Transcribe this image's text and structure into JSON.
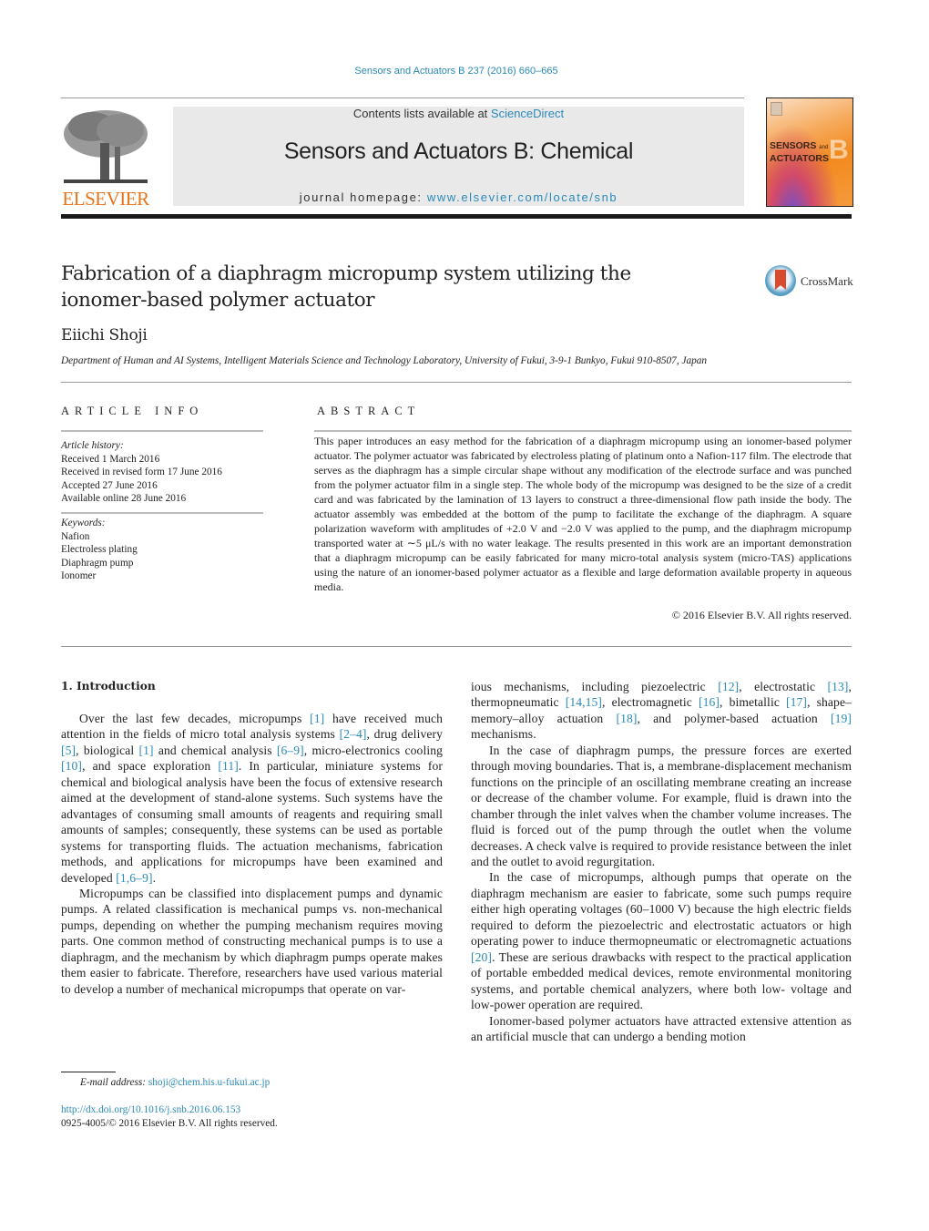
{
  "header": {
    "journal_ref": "Sensors and Actuators B 237 (2016) 660–665",
    "contents_prefix": "Contents lists available at ",
    "contents_link": "ScienceDirect",
    "journal_name": "Sensors and Actuators B: Chemical",
    "homepage_prefix": "journal homepage: ",
    "homepage_link": "www.elsevier.com/locate/snb",
    "publisher_logo_text": "ELSEVIER",
    "cover": {
      "line1": "SENSORS",
      "and": "and",
      "line2": "ACTUATORS",
      "letter": "B"
    },
    "brand_colors": {
      "link": "#2a8ab8",
      "elsevier_orange": "#e8731a",
      "banner_bg": "#e9e9ea"
    }
  },
  "article": {
    "title": "Fabrication of a diaphragm micropump system utilizing the ionomer-based polymer actuator",
    "crossmark_label": "CrossMark",
    "author": "Eiichi Shoji",
    "affiliation": "Department of Human and AI Systems, Intelligent Materials Science and Technology Laboratory, University of Fukui, 3-9-1 Bunkyo, Fukui 910-8507, Japan"
  },
  "article_info": {
    "heading": "ARTICLE INFO",
    "history_label": "Article history:",
    "history": [
      "Received 1 March 2016",
      "Received in revised form 17 June 2016",
      "Accepted 27 June 2016",
      "Available online 28 June 2016"
    ],
    "keywords_label": "Keywords:",
    "keywords": [
      "Nafion",
      "Electroless plating",
      "Diaphragm pump",
      "Ionomer"
    ]
  },
  "abstract": {
    "heading": "ABSTRACT",
    "text": "This paper introduces an easy method for the fabrication of a diaphragm micropump using an ionomer-based polymer actuator. The polymer actuator was fabricated by electroless plating of platinum onto a Nafion-117 film. The electrode that serves as the diaphragm has a simple circular shape without any modification of the electrode surface and was punched from the polymer actuator film in a single step. The whole body of the micropump was designed to be the size of a credit card and was fabricated by the lamination of 13 layers to construct a three-dimensional flow path inside the body. The actuator assembly was embedded at the bottom of the pump to facilitate the exchange of the diaphragm. A square polarization waveform with amplitudes of +2.0 V and −2.0 V was applied to the pump, and the diaphragm micropump transported water at ∼5 μL/s with no water leakage. The results presented in this work are an important demonstration that a diaphragm micropump can be easily fabricated for many micro-total analysis system (micro-TAS) applications using the nature of an ionomer-based polymer actuator as a flexible and large deformation available property in aqueous media.",
    "copyright": "© 2016 Elsevier B.V. All rights reserved."
  },
  "body": {
    "section_heading": "1.  Introduction",
    "left_paragraphs": [
      [
        {
          "t": "Over the last few decades, micropumps "
        },
        {
          "c": "[1]"
        },
        {
          "t": " have received much attention in the fields of micro total analysis systems "
        },
        {
          "c": "[2–4]"
        },
        {
          "t": ", drug delivery "
        },
        {
          "c": "[5]"
        },
        {
          "t": ", biological "
        },
        {
          "c": "[1]"
        },
        {
          "t": " and chemical analysis "
        },
        {
          "c": "[6–9]"
        },
        {
          "t": ", micro-electronics cooling "
        },
        {
          "c": "[10]"
        },
        {
          "t": ", and space exploration "
        },
        {
          "c": "[11]"
        },
        {
          "t": ". In particular, miniature systems for chemical and biological analysis have been the focus of extensive research aimed at the development of stand-alone systems. Such systems have the advantages of consuming small amounts of reagents and requiring small amounts of samples; consequently, these systems can be used as portable systems for transporting fluids. The actuation mechanisms, fabrication methods, and applications for micropumps have been examined and developed "
        },
        {
          "c": "[1,6–9]"
        },
        {
          "t": "."
        }
      ],
      [
        {
          "t": "Micropumps can be classified into displacement pumps and dynamic pumps. A related classification is mechanical pumps vs. non-mechanical pumps, depending on whether the pumping mechanism requires moving parts. One common method of constructing mechanical pumps is to use a diaphragm, and the mechanism by which diaphragm pumps operate makes them easier to fabricate. Therefore, researchers have used various material to develop a number of mechanical micropumps that operate on var-"
        }
      ]
    ],
    "right_paragraphs": [
      [
        {
          "t": "ious mechanisms, including piezoelectric "
        },
        {
          "c": "[12]"
        },
        {
          "t": ", electrostatic "
        },
        {
          "c": "[13]"
        },
        {
          "t": ", thermopneumatic "
        },
        {
          "c": "[14,15]"
        },
        {
          "t": ", electromagnetic "
        },
        {
          "c": "[16]"
        },
        {
          "t": ", bimetallic "
        },
        {
          "c": "[17]"
        },
        {
          "t": ", shape–memory–alloy actuation "
        },
        {
          "c": "[18]"
        },
        {
          "t": ", and polymer-based actuation "
        },
        {
          "c": "[19]"
        },
        {
          "t": " mechanisms."
        }
      ],
      [
        {
          "t": "In the case of diaphragm pumps, the pressure forces are exerted through moving boundaries. That is, a membrane-displacement mechanism functions on the principle of an oscillating membrane creating an increase or decrease of the chamber volume. For example, fluid is drawn into the chamber through the inlet valves when the chamber volume increases. The fluid is forced out of the pump through the outlet when the volume decreases. A check valve is required to provide resistance between the inlet and the outlet to avoid regurgitation."
        }
      ],
      [
        {
          "t": "In the case of micropumps, although pumps that operate on the diaphragm mechanism are easier to fabricate, some such pumps require either high operating voltages (60–1000 V) because the high electric fields required to deform the piezoelectric and electrostatic actuators or high operating power to induce thermopneumatic or electromagnetic actuations "
        },
        {
          "c": "[20]"
        },
        {
          "t": ". These are serious drawbacks with respect to the practical application of portable embedded medical devices, remote environmental monitoring systems, and portable chemical analyzers, where both low- voltage and low-power operation are required."
        }
      ],
      [
        {
          "t": "Ionomer-based polymer actuators have attracted extensive attention as an artificial muscle that can undergo a bending motion"
        }
      ]
    ]
  },
  "footer": {
    "email_label": "E-mail address:",
    "email": "shoji@chem.his.u-fukui.ac.jp",
    "doi": "http://dx.doi.org/10.1016/j.snb.2016.06.153",
    "issn": "0925-4005/© 2016 Elsevier B.V. All rights reserved."
  }
}
